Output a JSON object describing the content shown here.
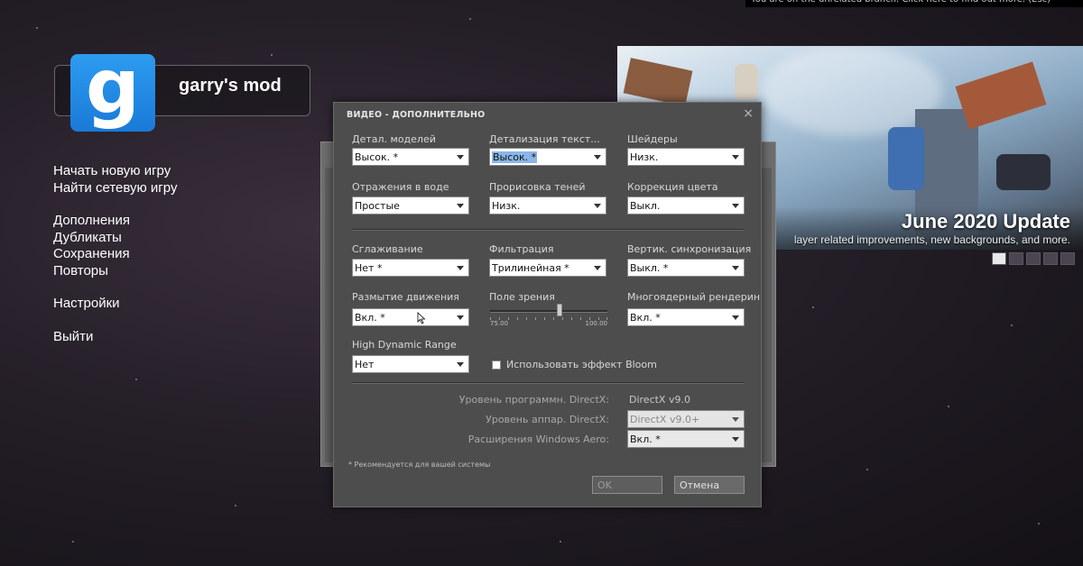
{
  "top_banner": "You are on the unrelated branch. Click here to find out more. (Esc)",
  "logo": {
    "mark": "g",
    "title": "garry's mod"
  },
  "menu": {
    "group1": [
      "Начать новую игру",
      "Найти сетевую игру"
    ],
    "group2": [
      "Дополнения",
      "Дубликаты",
      "Сохранения",
      "Повторы"
    ],
    "group3": [
      "Настройки"
    ],
    "group4": [
      "Выйти"
    ]
  },
  "promo": {
    "title": "June 2020 Update",
    "subtitle": "layer related improvements, new backgrounds, and more."
  },
  "dialog": {
    "title": "ВИДЕО - ДОПОЛНИТЕЛЬНО",
    "close": "×",
    "model_detail": {
      "label": "Детал. моделей",
      "value": "Высок. *"
    },
    "texture_detail": {
      "label": "Детализация текст...",
      "value": "Высок. *"
    },
    "shader_detail": {
      "label": "Шейдеры",
      "value": "Низк."
    },
    "water_detail": {
      "label": "Отражения в воде",
      "value": "Простые"
    },
    "shadow_detail": {
      "label": "Прорисовка теней",
      "value": "Низк."
    },
    "color_correction": {
      "label": "Коррекция цвета",
      "value": "Выкл."
    },
    "antialiasing": {
      "label": "Сглаживание",
      "value": "Нет *"
    },
    "filtering": {
      "label": "Фильтрация",
      "value": "Трилинейная *"
    },
    "vsync": {
      "label": "Вертик. синхронизация",
      "value": "Выкл. *"
    },
    "motion_blur": {
      "label": "Размытие движения",
      "value": "Вкл. *"
    },
    "fov": {
      "label": "Поле зрения",
      "min_label": "75.00",
      "max_label": "100.00",
      "fraction": 0.6
    },
    "multicore": {
      "label": "Многоядерный рендеринг",
      "value": "Вкл. *"
    },
    "hdr": {
      "label": "High Dynamic Range",
      "value": "Нет"
    },
    "bloom": {
      "label": "Использовать эффект Bloom",
      "checked": false
    },
    "dx_software": {
      "label": "Уровень программн. DirectX:",
      "value": "DirectX v9.0"
    },
    "dx_hardware": {
      "label": "Уровень аппар. DirectX:",
      "value": "DirectX v9.0+"
    },
    "aero": {
      "label": "Расширения Windows Aero:",
      "value": "Вкл. *"
    },
    "note": "* Рекомендуется для вашей системы",
    "ok": "OK",
    "cancel": "Отмена"
  }
}
